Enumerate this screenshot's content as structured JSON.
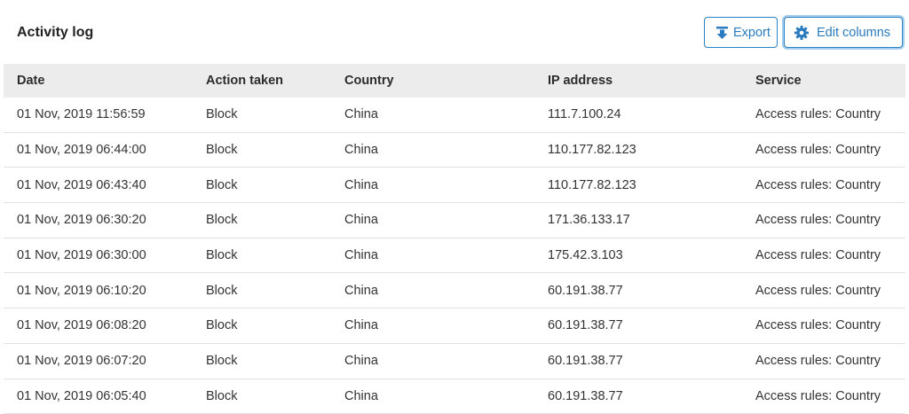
{
  "title": "Activity log",
  "toolbar": {
    "export_label": "Export",
    "edit_columns_label": "Edit columns",
    "accent": "#2a7bbf"
  },
  "table": {
    "columns": [
      "Date",
      "Action taken",
      "Country",
      "IP address",
      "Service"
    ],
    "rows": [
      [
        "01 Nov, 2019 11:56:59",
        "Block",
        "China",
        "111.7.100.24",
        "Access rules: Country"
      ],
      [
        "01 Nov, 2019 06:44:00",
        "Block",
        "China",
        "110.177.82.123",
        "Access rules: Country"
      ],
      [
        "01 Nov, 2019 06:43:40",
        "Block",
        "China",
        "110.177.82.123",
        "Access rules: Country"
      ],
      [
        "01 Nov, 2019 06:30:20",
        "Block",
        "China",
        "171.36.133.17",
        "Access rules: Country"
      ],
      [
        "01 Nov, 2019 06:30:00",
        "Block",
        "China",
        "175.42.3.103",
        "Access rules: Country"
      ],
      [
        "01 Nov, 2019 06:10:20",
        "Block",
        "China",
        "60.191.38.77",
        "Access rules: Country"
      ],
      [
        "01 Nov, 2019 06:08:20",
        "Block",
        "China",
        "60.191.38.77",
        "Access rules: Country"
      ],
      [
        "01 Nov, 2019 06:07:20",
        "Block",
        "China",
        "60.191.38.77",
        "Access rules: Country"
      ],
      [
        "01 Nov, 2019 06:05:40",
        "Block",
        "China",
        "60.191.38.77",
        "Access rules: Country"
      ]
    ]
  },
  "icons": {
    "export": "download-arrow-icon",
    "edit_columns": "gear-icon"
  }
}
